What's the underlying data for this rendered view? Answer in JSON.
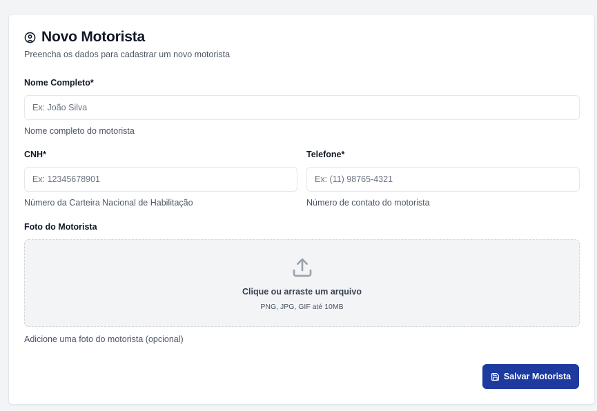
{
  "header": {
    "title": "Novo Motorista",
    "subtitle": "Preencha os dados para cadastrar um novo motorista",
    "icon": "user-circle-icon"
  },
  "form": {
    "name": {
      "label": "Nome Completo*",
      "placeholder": "Ex: João Silva",
      "help": "Nome completo do motorista"
    },
    "cnh": {
      "label": "CNH*",
      "placeholder": "Ex: 12345678901",
      "help": "Número da Carteira Nacional de Habilitação"
    },
    "phone": {
      "label": "Telefone*",
      "placeholder": "Ex: (11) 98765-4321",
      "help": "Número de contato do motorista"
    },
    "photo": {
      "label": "Foto do Motorista",
      "drop_title": "Clique ou arraste um arquivo",
      "drop_sub": "PNG, JPG, GIF até 10MB",
      "help": "Adicione uma foto do motorista (opcional)",
      "icon": "upload-icon"
    }
  },
  "actions": {
    "save_label": "Salvar Motorista",
    "save_icon": "save-icon"
  },
  "colors": {
    "primary": "#1e3a9f",
    "background": "#f3f4f6",
    "card": "#ffffff"
  }
}
